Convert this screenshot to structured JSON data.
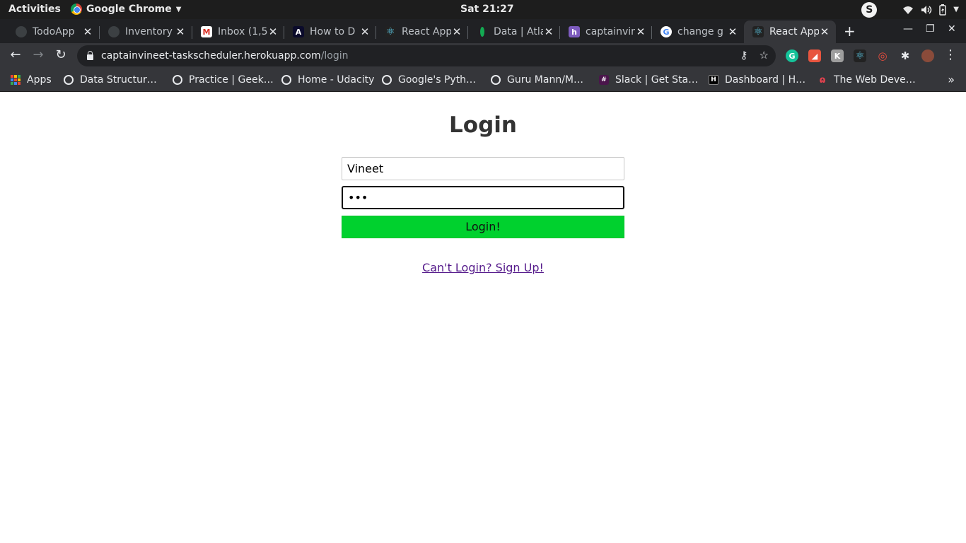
{
  "system_bar": {
    "activities": "Activities",
    "app_name": "Google Chrome",
    "clock": "Sat 21:27",
    "badge": "S"
  },
  "tabs": [
    {
      "title": "TodoApp",
      "icon": "github-icon",
      "active": false
    },
    {
      "title": "Inventory",
      "icon": "github-icon",
      "active": false
    },
    {
      "title": "Inbox (1,5",
      "icon": "gmail-icon",
      "active": false
    },
    {
      "title": "How to D",
      "icon": "angular-icon",
      "active": false
    },
    {
      "title": "React App",
      "icon": "react-icon",
      "active": false
    },
    {
      "title": "Data | Atla",
      "icon": "mongodb-leaf-icon",
      "active": false
    },
    {
      "title": "captainvin",
      "icon": "heroku-icon",
      "active": false
    },
    {
      "title": "change g",
      "icon": "google-icon",
      "active": false
    },
    {
      "title": "React App",
      "icon": "react-icon",
      "active": true
    }
  ],
  "address_bar": {
    "host": "captainvineet-taskscheduler.herokuapp.com",
    "path": "/login"
  },
  "bookmarks": [
    {
      "label": "Apps",
      "icon": "apps-grid-icon"
    },
    {
      "label": "Data Structur…",
      "icon": "globe-icon"
    },
    {
      "label": "Practice | Geek…",
      "icon": "globe-icon"
    },
    {
      "label": "Home - Udacity",
      "icon": "globe-icon"
    },
    {
      "label": "Google's Pyth…",
      "icon": "globe-icon"
    },
    {
      "label": "Guru Mann/M…",
      "icon": "globe-icon"
    },
    {
      "label": "Slack | Get Sta…",
      "icon": "slack-icon"
    },
    {
      "label": "Dashboard | H…",
      "icon": "hackerearth-icon"
    },
    {
      "label": "The Web Deve…",
      "icon": "webdev-icon"
    }
  ],
  "login": {
    "title": "Login",
    "username_value": "Vineet",
    "password_value": "•••",
    "button_label": "Login!",
    "signup_link": "Can't Login? Sign Up!"
  },
  "colors": {
    "login_button": "#00d12e",
    "link": "#551a8b",
    "chrome_dark": "#202124",
    "toolbar": "#35363a"
  }
}
